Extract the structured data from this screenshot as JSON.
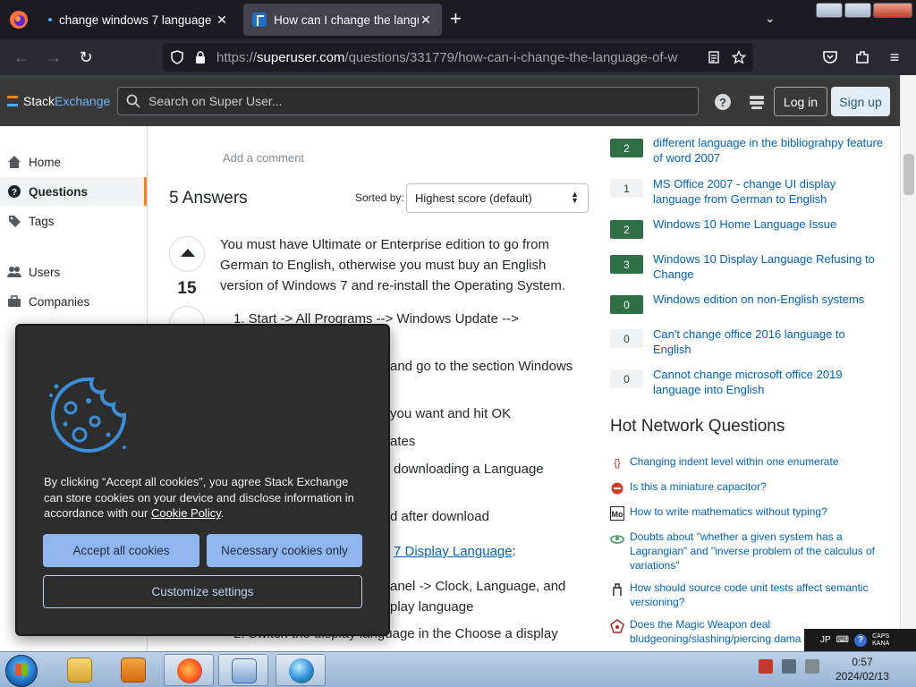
{
  "browser": {
    "tabs": [
      {
        "title": "change windows 7 language"
      },
      {
        "title": "How can I change the language"
      }
    ],
    "url": {
      "scheme": "https://",
      "host": "superuser.com",
      "path": "/questions/331779/how-can-i-change-the-language-of-w"
    }
  },
  "header": {
    "logo_prefix": "Stack",
    "logo_suffix": "Exchange",
    "search_placeholder": "Search on Super User...",
    "login_label": "Log in",
    "signup_label": "Sign up"
  },
  "sidebar": {
    "items": [
      {
        "label": "Home",
        "icon": "home-icon"
      },
      {
        "label": "Questions",
        "icon": "questions-icon"
      },
      {
        "label": "Tags",
        "icon": "tag-icon"
      },
      {
        "label": "Users",
        "icon": "users-icon"
      },
      {
        "label": "Companies",
        "icon": "companies-icon"
      }
    ]
  },
  "main": {
    "add_comment": "Add a comment",
    "answers_title": "5 Answers",
    "sorted_by_label": "Sorted by:",
    "sort_value": "Highest score (default)",
    "answer": {
      "votes": "15",
      "text": "You must have Ultimate or Enterprise edition to go from German to English, otherwise you must buy an English version of Windows 7 and re-install the Operating System.",
      "step1": "1. Start -> All Programs --> Windows Update -->",
      "line_a": "and go to the section Windows",
      "line_b": "you want and hit OK",
      "line_c": "ates",
      "line_d": "downloading a Language",
      "line_e": "d after download",
      "link_text": "7 Display Language",
      "link_suffix": ":",
      "line_f": "anel -> Clock, Language, and",
      "line_g": "play language",
      "line_h": "2. Switch the display language in the Choose a display"
    }
  },
  "related": [
    {
      "score": "2",
      "answered": true,
      "title": "different language in the bibliograhpy feature of word 2007"
    },
    {
      "score": "1",
      "answered": false,
      "title": "MS Office 2007 - change UI display language from German to English"
    },
    {
      "score": "2",
      "answered": true,
      "title": "Windows 10 Home Language Issue"
    },
    {
      "score": "3",
      "answered": true,
      "title": "Windows 10 Display Language Refusing to Change"
    },
    {
      "score": "0",
      "answered": true,
      "title": "Windows edition on non-English systems"
    },
    {
      "score": "0",
      "answered": false,
      "title": "Can't change office 2016 language to English"
    },
    {
      "score": "0",
      "answered": false,
      "title": "Cannot change microsoft office 2019 language into English"
    }
  ],
  "hot_network": {
    "title": "Hot Network Questions",
    "items": [
      {
        "title": "Changing indent level within one enumerate",
        "icon": "tex-icon"
      },
      {
        "title": "Is this a miniature capacitor?",
        "icon": "electronics-icon"
      },
      {
        "title": "How to write mathematics without typing?",
        "icon": "math-icon"
      },
      {
        "title": "Doubts about \"whether a given system has a Lagrangian\" and \"inverse problem of the calculus of variations\"",
        "icon": "physics-icon"
      },
      {
        "title": "How should source code unit tests affect semantic versioning?",
        "icon": "softeng-icon"
      },
      {
        "title": "Does the Magic Weapon deal bludgeoning/slashing/piercing dama",
        "icon": "rpg-icon"
      }
    ]
  },
  "cookie": {
    "text": "By clicking “Accept all cookies”, you agree Stack Exchange can store cookies on your device and disclose information in accordance with our ",
    "policy_link": "Cookie Policy",
    "policy_suffix": ".",
    "accept_label": "Accept all cookies",
    "necessary_label": "Necessary cookies only",
    "customize_label": "Customize settings"
  },
  "taskbar": {
    "time": "0:57",
    "date": "2024/02/13",
    "ime": {
      "lang": "JP",
      "caps": "CAPS",
      "kana": "KANA"
    }
  },
  "colors": {
    "accent": "#f48225",
    "link": "#0063bf",
    "answered_score": "#2f6f44",
    "cookie_button": "#8fb6ef"
  }
}
